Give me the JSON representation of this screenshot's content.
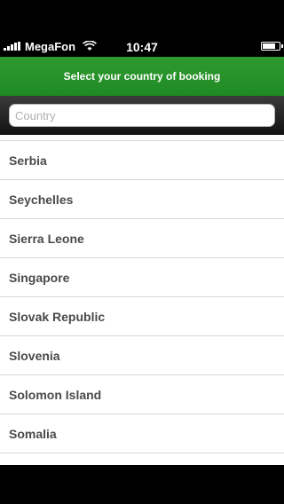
{
  "status_bar": {
    "carrier": "MegaFon",
    "time": "10:47",
    "icons": [
      "signal-icon",
      "wifi-icon",
      "battery-icon"
    ]
  },
  "header": {
    "title": "Select your country of booking",
    "color": "#2a942a"
  },
  "search": {
    "placeholder": "Country",
    "value": ""
  },
  "countries": [
    "Serbia",
    "Seychelles",
    "Sierra Leone",
    "Singapore",
    "Slovak Republic",
    "Slovenia",
    "Solomon Island",
    "Somalia"
  ]
}
